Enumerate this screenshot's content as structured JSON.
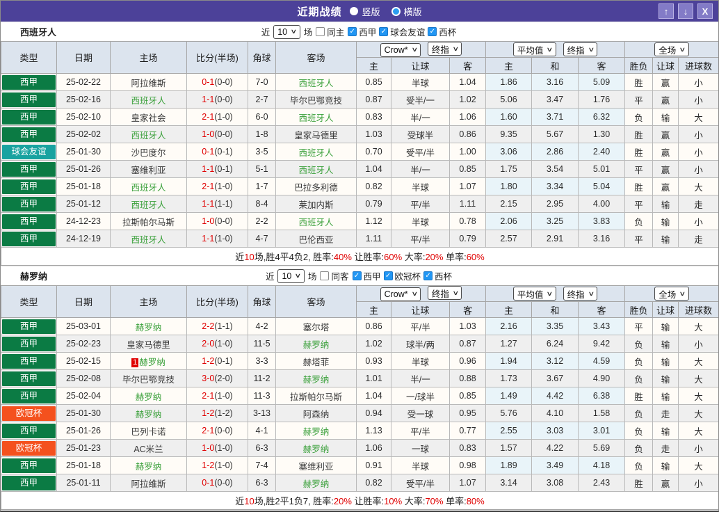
{
  "titlebar": {
    "title": "近期战绩",
    "radios": [
      {
        "label": "竖版",
        "selected": true
      },
      {
        "label": "横版",
        "selected": false
      }
    ],
    "up_icon": "↑",
    "down_icon": "↓",
    "close_icon": "X"
  },
  "colors": {
    "titlebar_bg": "#4c4199",
    "comp": {
      "西甲": "#0b7b44",
      "球会友谊": "#18a2a0",
      "欧冠杯": "#f4511e"
    },
    "result": {
      "r": "#d60000",
      "g": "#00a050",
      "b": "#2d2dd6"
    },
    "team_green": "#3aa03a",
    "score_red": "#e00000",
    "checkbox_blue": "#2196f3"
  },
  "table": {
    "columns": [
      "类型",
      "日期",
      "主场",
      "比分(半场)",
      "角球",
      "客场"
    ],
    "odds_columns": [
      "主",
      "让球",
      "客",
      "主",
      "和",
      "客",
      "胜负",
      "让球",
      "进球数"
    ],
    "dropdowns": {
      "g1a": "Crow*",
      "g1b": "终指",
      "g2a": "平均值",
      "g2b": "终指",
      "g3": "全场"
    }
  },
  "sections": [
    {
      "team": "西班牙人",
      "filters": {
        "near": "近",
        "count": "10",
        "games": "场",
        "same": {
          "label": "同主",
          "checked": false
        },
        "leagues": [
          {
            "label": "西甲",
            "checked": true
          },
          {
            "label": "球会友谊",
            "checked": true
          },
          {
            "label": "西杯",
            "checked": true
          }
        ]
      },
      "rows": [
        {
          "comp": "西甲",
          "date": "25-02-22",
          "home": "阿拉维斯",
          "home_team": false,
          "home_badge": "",
          "score": "0-1",
          "half": "(0-0)",
          "corners": "7-0",
          "away": "西班牙人",
          "away_team": true,
          "odds1": [
            "0.85",
            "半球",
            "1.04"
          ],
          "odds2": [
            "1.86",
            "3.16",
            "5.09"
          ],
          "results": [
            [
              "胜",
              "r"
            ],
            [
              "赢",
              "r"
            ],
            [
              "小",
              "b"
            ]
          ]
        },
        {
          "comp": "西甲",
          "date": "25-02-16",
          "home": "西班牙人",
          "home_team": true,
          "home_badge": "",
          "score": "1-1",
          "half": "(0-0)",
          "corners": "2-7",
          "away": "毕尔巴鄂竞技",
          "away_team": false,
          "odds1": [
            "0.87",
            "受半/一",
            "1.02"
          ],
          "odds2": [
            "5.06",
            "3.47",
            "1.76"
          ],
          "results": [
            [
              "平",
              "g"
            ],
            [
              "赢",
              "r"
            ],
            [
              "小",
              "b"
            ]
          ]
        },
        {
          "comp": "西甲",
          "date": "25-02-10",
          "home": "皇家社会",
          "home_team": false,
          "home_badge": "",
          "score": "2-1",
          "half": "(1-0)",
          "corners": "6-0",
          "away": "西班牙人",
          "away_team": true,
          "odds1": [
            "0.83",
            "半/一",
            "1.06"
          ],
          "odds2": [
            "1.60",
            "3.71",
            "6.32"
          ],
          "results": [
            [
              "负",
              "b"
            ],
            [
              "输",
              "b"
            ],
            [
              "大",
              "r"
            ]
          ]
        },
        {
          "comp": "西甲",
          "date": "25-02-02",
          "home": "西班牙人",
          "home_team": true,
          "home_badge": "",
          "score": "1-0",
          "half": "(0-0)",
          "corners": "1-8",
          "away": "皇家马德里",
          "away_team": false,
          "odds1": [
            "1.03",
            "受球半",
            "0.86"
          ],
          "odds2": [
            "9.35",
            "5.67",
            "1.30"
          ],
          "results": [
            [
              "胜",
              "r"
            ],
            [
              "赢",
              "r"
            ],
            [
              "小",
              "b"
            ]
          ]
        },
        {
          "comp": "球会友谊",
          "date": "25-01-30",
          "home": "沙巴度尔",
          "home_team": false,
          "home_badge": "",
          "score": "0-1",
          "half": "(0-1)",
          "corners": "3-5",
          "away": "西班牙人",
          "away_team": true,
          "odds1": [
            "0.70",
            "受平/半",
            "1.00"
          ],
          "odds2": [
            "3.06",
            "2.86",
            "2.40"
          ],
          "results": [
            [
              "胜",
              "r"
            ],
            [
              "赢",
              "r"
            ],
            [
              "小",
              "b"
            ]
          ]
        },
        {
          "comp": "西甲",
          "date": "25-01-26",
          "home": "塞维利亚",
          "home_team": false,
          "home_badge": "",
          "score": "1-1",
          "half": "(0-1)",
          "corners": "5-1",
          "away": "西班牙人",
          "away_team": true,
          "odds1": [
            "1.04",
            "半/一",
            "0.85"
          ],
          "odds2": [
            "1.75",
            "3.54",
            "5.01"
          ],
          "results": [
            [
              "平",
              "g"
            ],
            [
              "赢",
              "r"
            ],
            [
              "小",
              "b"
            ]
          ]
        },
        {
          "comp": "西甲",
          "date": "25-01-18",
          "home": "西班牙人",
          "home_team": true,
          "home_badge": "",
          "score": "2-1",
          "half": "(1-0)",
          "corners": "1-7",
          "away": "巴拉多利德",
          "away_team": false,
          "odds1": [
            "0.82",
            "半球",
            "1.07"
          ],
          "odds2": [
            "1.80",
            "3.34",
            "5.04"
          ],
          "results": [
            [
              "胜",
              "r"
            ],
            [
              "赢",
              "r"
            ],
            [
              "大",
              "r"
            ]
          ]
        },
        {
          "comp": "西甲",
          "date": "25-01-12",
          "home": "西班牙人",
          "home_team": true,
          "home_badge": "",
          "score": "1-1",
          "half": "(1-1)",
          "corners": "8-4",
          "away": "莱加内斯",
          "away_team": false,
          "odds1": [
            "0.79",
            "平/半",
            "1.11"
          ],
          "odds2": [
            "2.15",
            "2.95",
            "4.00"
          ],
          "results": [
            [
              "平",
              "g"
            ],
            [
              "输",
              "b"
            ],
            [
              "走",
              "g"
            ]
          ]
        },
        {
          "comp": "西甲",
          "date": "24-12-23",
          "home": "拉斯帕尔马斯",
          "home_team": false,
          "home_badge": "",
          "score": "1-0",
          "half": "(0-0)",
          "corners": "2-2",
          "away": "西班牙人",
          "away_team": true,
          "odds1": [
            "1.12",
            "半球",
            "0.78"
          ],
          "odds2": [
            "2.06",
            "3.25",
            "3.83"
          ],
          "results": [
            [
              "负",
              "b"
            ],
            [
              "输",
              "b"
            ],
            [
              "小",
              "b"
            ]
          ]
        },
        {
          "comp": "西甲",
          "date": "24-12-19",
          "home": "西班牙人",
          "home_team": true,
          "home_badge": "",
          "score": "1-1",
          "half": "(1-0)",
          "corners": "4-7",
          "away": "巴伦西亚",
          "away_team": false,
          "odds1": [
            "1.11",
            "平/半",
            "0.79"
          ],
          "odds2": [
            "2.57",
            "2.91",
            "3.16"
          ],
          "results": [
            [
              "平",
              "g"
            ],
            [
              "输",
              "b"
            ],
            [
              "走",
              "g"
            ]
          ]
        }
      ],
      "summary": [
        [
          "近",
          "k"
        ],
        [
          "10",
          "r"
        ],
        [
          "场,胜4平4负2, 胜率:",
          "k"
        ],
        [
          "40%",
          "r"
        ],
        [
          " 让胜率:",
          "k"
        ],
        [
          "60%",
          "r"
        ],
        [
          " 大率:",
          "k"
        ],
        [
          "20%",
          "r"
        ],
        [
          " 单率:",
          "k"
        ],
        [
          "60%",
          "r"
        ]
      ]
    },
    {
      "team": "赫罗纳",
      "filters": {
        "near": "近",
        "count": "10",
        "games": "场",
        "same": {
          "label": "同客",
          "checked": false
        },
        "leagues": [
          {
            "label": "西甲",
            "checked": true
          },
          {
            "label": "欧冠杯",
            "checked": true
          },
          {
            "label": "西杯",
            "checked": true
          }
        ]
      },
      "rows": [
        {
          "comp": "西甲",
          "date": "25-03-01",
          "home": "赫罗纳",
          "home_team": true,
          "home_badge": "",
          "score": "2-2",
          "half": "(1-1)",
          "corners": "4-2",
          "away": "塞尔塔",
          "away_team": false,
          "odds1": [
            "0.86",
            "平/半",
            "1.03"
          ],
          "odds2": [
            "2.16",
            "3.35",
            "3.43"
          ],
          "results": [
            [
              "平",
              "g"
            ],
            [
              "输",
              "b"
            ],
            [
              "大",
              "r"
            ]
          ]
        },
        {
          "comp": "西甲",
          "date": "25-02-23",
          "home": "皇家马德里",
          "home_team": false,
          "home_badge": "",
          "score": "2-0",
          "half": "(1-0)",
          "corners": "11-5",
          "away": "赫罗纳",
          "away_team": true,
          "odds1": [
            "1.02",
            "球半/两",
            "0.87"
          ],
          "odds2": [
            "1.27",
            "6.24",
            "9.42"
          ],
          "results": [
            [
              "负",
              "b"
            ],
            [
              "输",
              "b"
            ],
            [
              "小",
              "b"
            ]
          ]
        },
        {
          "comp": "西甲",
          "date": "25-02-15",
          "home": "赫罗纳",
          "home_team": true,
          "home_badge": "1",
          "score": "1-2",
          "half": "(0-1)",
          "corners": "3-3",
          "away": "赫塔菲",
          "away_team": false,
          "odds1": [
            "0.93",
            "半球",
            "0.96"
          ],
          "odds2": [
            "1.94",
            "3.12",
            "4.59"
          ],
          "results": [
            [
              "负",
              "b"
            ],
            [
              "输",
              "b"
            ],
            [
              "大",
              "r"
            ]
          ]
        },
        {
          "comp": "西甲",
          "date": "25-02-08",
          "home": "毕尔巴鄂竞技",
          "home_team": false,
          "home_badge": "",
          "score": "3-0",
          "half": "(2-0)",
          "corners": "11-2",
          "away": "赫罗纳",
          "away_team": true,
          "odds1": [
            "1.01",
            "半/一",
            "0.88"
          ],
          "odds2": [
            "1.73",
            "3.67",
            "4.90"
          ],
          "results": [
            [
              "负",
              "b"
            ],
            [
              "输",
              "b"
            ],
            [
              "大",
              "r"
            ]
          ]
        },
        {
          "comp": "西甲",
          "date": "25-02-04",
          "home": "赫罗纳",
          "home_team": true,
          "home_badge": "",
          "score": "2-1",
          "half": "(1-0)",
          "corners": "11-3",
          "away": "拉斯帕尔马斯",
          "away_team": false,
          "odds1": [
            "1.04",
            "一/球半",
            "0.85"
          ],
          "odds2": [
            "1.49",
            "4.42",
            "6.38"
          ],
          "results": [
            [
              "胜",
              "r"
            ],
            [
              "输",
              "b"
            ],
            [
              "大",
              "r"
            ]
          ]
        },
        {
          "comp": "欧冠杯",
          "date": "25-01-30",
          "home": "赫罗纳",
          "home_team": true,
          "home_badge": "",
          "score": "1-2",
          "half": "(1-2)",
          "corners": "3-13",
          "away": "阿森纳",
          "away_team": false,
          "odds1": [
            "0.94",
            "受一球",
            "0.95"
          ],
          "odds2": [
            "5.76",
            "4.10",
            "1.58"
          ],
          "results": [
            [
              "负",
              "b"
            ],
            [
              "走",
              "g"
            ],
            [
              "大",
              "r"
            ]
          ]
        },
        {
          "comp": "西甲",
          "date": "25-01-26",
          "home": "巴列卡诺",
          "home_team": false,
          "home_badge": "",
          "score": "2-1",
          "half": "(0-0)",
          "corners": "4-1",
          "away": "赫罗纳",
          "away_team": true,
          "odds1": [
            "1.13",
            "平/半",
            "0.77"
          ],
          "odds2": [
            "2.55",
            "3.03",
            "3.01"
          ],
          "results": [
            [
              "负",
              "b"
            ],
            [
              "输",
              "b"
            ],
            [
              "大",
              "r"
            ]
          ]
        },
        {
          "comp": "欧冠杯",
          "date": "25-01-23",
          "home": "AC米兰",
          "home_team": false,
          "home_badge": "",
          "score": "1-0",
          "half": "(1-0)",
          "corners": "6-3",
          "away": "赫罗纳",
          "away_team": true,
          "odds1": [
            "1.06",
            "一球",
            "0.83"
          ],
          "odds2": [
            "1.57",
            "4.22",
            "5.69"
          ],
          "results": [
            [
              "负",
              "b"
            ],
            [
              "走",
              "g"
            ],
            [
              "小",
              "b"
            ]
          ]
        },
        {
          "comp": "西甲",
          "date": "25-01-18",
          "home": "赫罗纳",
          "home_team": true,
          "home_badge": "",
          "score": "1-2",
          "half": "(1-0)",
          "corners": "7-4",
          "away": "塞维利亚",
          "away_team": false,
          "odds1": [
            "0.91",
            "半球",
            "0.98"
          ],
          "odds2": [
            "1.89",
            "3.49",
            "4.18"
          ],
          "results": [
            [
              "负",
              "b"
            ],
            [
              "输",
              "b"
            ],
            [
              "大",
              "r"
            ]
          ]
        },
        {
          "comp": "西甲",
          "date": "25-01-11",
          "home": "阿拉维斯",
          "home_team": false,
          "home_badge": "",
          "score": "0-1",
          "half": "(0-0)",
          "corners": "6-3",
          "away": "赫罗纳",
          "away_team": true,
          "odds1": [
            "0.82",
            "受平/半",
            "1.07"
          ],
          "odds2": [
            "3.14",
            "3.08",
            "2.43"
          ],
          "results": [
            [
              "胜",
              "r"
            ],
            [
              "赢",
              "r"
            ],
            [
              "小",
              "b"
            ]
          ]
        }
      ],
      "summary": [
        [
          "近",
          "k"
        ],
        [
          "10",
          "r"
        ],
        [
          "场,胜2平1负7, 胜率:",
          "k"
        ],
        [
          "20%",
          "r"
        ],
        [
          " 让胜率:",
          "k"
        ],
        [
          "10%",
          "r"
        ],
        [
          " 大率:",
          "k"
        ],
        [
          "70%",
          "r"
        ],
        [
          " 单率:",
          "k"
        ],
        [
          "80%",
          "r"
        ]
      ]
    }
  ]
}
